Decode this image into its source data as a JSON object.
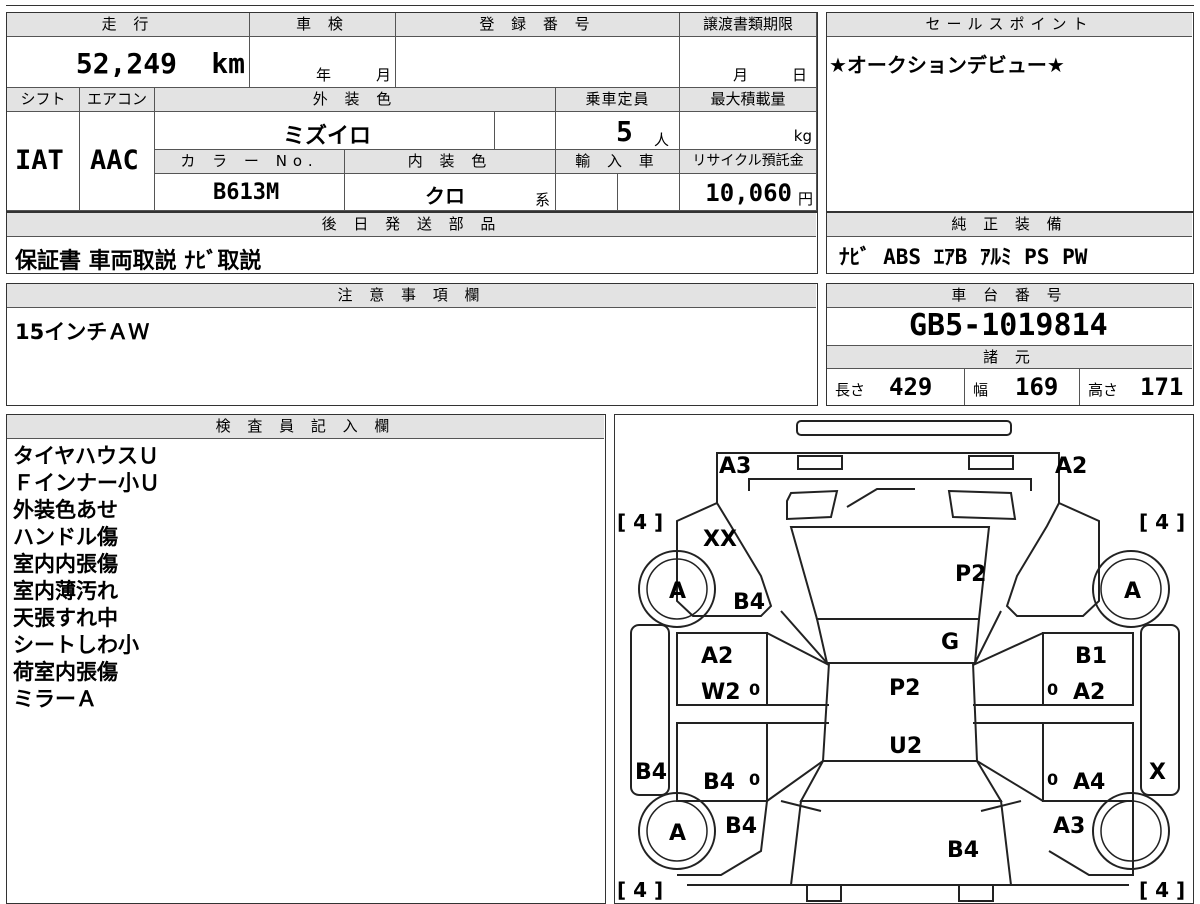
{
  "sheet": {
    "mileage_label": "走 行",
    "mileage": "52,249",
    "mileage_unit": "km",
    "shaken_label": "車 検",
    "shaken_year_unit": "年",
    "shaken_month_unit": "月",
    "reg_label": "登 録 番 号",
    "transfer_label": "譲渡書類期限",
    "transfer_month_unit": "月",
    "transfer_day_unit": "日",
    "shift_label": "シフト",
    "shift": "IAT",
    "ac_label": "エアコン",
    "ac": "AAC",
    "ext_color_label": "外 装 色",
    "ext_color": "ミズイロ",
    "capacity_label": "乗車定員",
    "capacity": "5",
    "capacity_unit": "人",
    "maxload_label": "最大積載量",
    "maxload_unit": "kg",
    "color_no_label": "カ ラ ー No.",
    "color_no": "B613M",
    "int_color_label": "内 装 色",
    "int_color": "クロ",
    "int_color_suffix": "系",
    "import_label": "輸 入 車",
    "recycle_label": "リサイクル預託金",
    "recycle": "10,060",
    "recycle_unit": "円",
    "later_label": "後 日 発 送 部 品",
    "later_items": "保証書 車両取説 ﾅﾋﾞ取説",
    "caution_label": "注 意 事 項 欄",
    "caution": "15インチＡＷ",
    "inspector_label": "検 査 員 記 入 欄",
    "inspector_notes": [
      "タイヤハウスＵ",
      "Ｆインナー小Ｕ",
      "外装色あせ",
      "ハンドル傷",
      "室内内張傷",
      "室内薄汚れ",
      "天張すれ中",
      "シートしわ小",
      "荷室内張傷",
      "ミラーＡ"
    ],
    "sales_label": "セールスポイント",
    "sales_point": "★オークションデビュー★",
    "equip_label": "純 正 装 備",
    "equipment": "ﾅﾋﾞ ABS ｴｱB ｱﾙﾐ PS PW",
    "chassis_label": "車 台 番 号",
    "chassis_no": "GB5-1019814",
    "specs_label": "諸 元",
    "length_label": "長さ",
    "length": "429",
    "width_label": "幅",
    "width": "169",
    "height_label": "高さ",
    "height": "171"
  },
  "diagram": {
    "tire_tl": "[ 4 ]",
    "tire_tr": "[ 4 ]",
    "tire_bl": "[ 4 ]",
    "tire_br": "[ 4 ]",
    "wheel_fl": "A",
    "wheel_fr": "A",
    "wheel_rl": "A",
    "m_a3_top": "A3",
    "m_a2_top": "A2",
    "m_xx": "XX",
    "m_p2_hood": "P2",
    "m_b4_fl": "B4",
    "m_g": "G",
    "m_a2_fdl": "A2",
    "m_w2": "W2",
    "m_b1": "B1",
    "m_a2_fdr": "A2",
    "m_p2_roof": "P2",
    "m_u2": "U2",
    "m_b4_side": "B4",
    "m_b4_rdl": "B4",
    "m_x": "X",
    "m_a4": "A4",
    "m_b4_rl": "B4",
    "m_a3_rr": "A3",
    "m_b4_trunk": "B4",
    "zero_1": "0",
    "zero_2": "0",
    "zero_3": "0",
    "zero_4": "0"
  }
}
